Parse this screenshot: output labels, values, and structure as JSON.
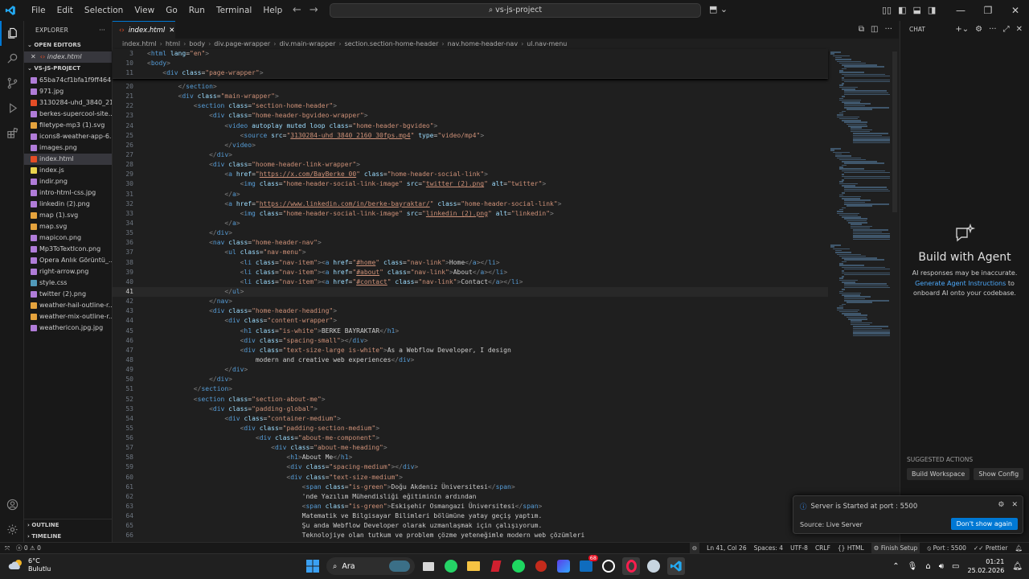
{
  "titlebar": {
    "menu": [
      "File",
      "Edit",
      "Selection",
      "View",
      "Go",
      "Run",
      "Terminal",
      "Help"
    ],
    "search": "vs-js-project"
  },
  "sidebar": {
    "title": "EXPLORER",
    "open_editors": "OPEN EDITORS",
    "open_file": "index.html",
    "project": "VS-JS-PROJECT",
    "files": [
      {
        "name": "65ba74cf1bfa1f9ff464...",
        "color": "#b07cd8"
      },
      {
        "name": "971.jpg",
        "color": "#b07cd8"
      },
      {
        "name": "3130284-uhd_3840_21...",
        "color": "#e44d26"
      },
      {
        "name": "berkes-supercool-site....",
        "color": "#b07cd8"
      },
      {
        "name": "filetype-mp3 (1).svg",
        "color": "#e5a33d"
      },
      {
        "name": "icons8-weather-app-6...",
        "color": "#b07cd8"
      },
      {
        "name": "images.png",
        "color": "#b07cd8"
      },
      {
        "name": "index.html",
        "color": "#e44d26"
      },
      {
        "name": "index.js",
        "color": "#e8d44d"
      },
      {
        "name": "indir.png",
        "color": "#b07cd8"
      },
      {
        "name": "intro-html-css.jpg",
        "color": "#b07cd8"
      },
      {
        "name": "linkedin (2).png",
        "color": "#b07cd8"
      },
      {
        "name": "map (1).svg",
        "color": "#e5a33d"
      },
      {
        "name": "map.svg",
        "color": "#e5a33d"
      },
      {
        "name": "mapicon.png",
        "color": "#b07cd8"
      },
      {
        "name": "Mp3ToTextIcon.png",
        "color": "#b07cd8"
      },
      {
        "name": "Opera Anlık Görüntü_...",
        "color": "#b07cd8"
      },
      {
        "name": "right-arrow.png",
        "color": "#b07cd8"
      },
      {
        "name": "style.css",
        "color": "#519aba"
      },
      {
        "name": "twitter (2).png",
        "color": "#b07cd8"
      },
      {
        "name": "weather-hail-outline-r...",
        "color": "#e5a33d"
      },
      {
        "name": "weather-mix-outline-r...",
        "color": "#e5a33d"
      },
      {
        "name": "weathericon.jpg.jpg",
        "color": "#b07cd8"
      }
    ],
    "outline": "OUTLINE",
    "timeline": "TIMELINE"
  },
  "editor": {
    "tab": "index.html",
    "breadcrumb": [
      "index.html",
      "html",
      "body",
      "div.page-wrapper",
      "div.main-wrapper",
      "section.section-home-header",
      "nav.home-header-nav",
      "ul.nav-menu"
    ],
    "sticky": [
      {
        "n": "3",
        "html": "<span class=\"t\">&lt;</span><span class=\"n\">html</span> <span class=\"a\">lang</span><span class=\"x\">=</span><span class=\"s\">\"en\"</span><span class=\"t\">&gt;</span>"
      },
      {
        "n": "10",
        "html": "<span class=\"t\">&lt;</span><span class=\"n\">body</span><span class=\"t\">&gt;</span>"
      },
      {
        "n": "11",
        "html": "    <span class=\"t\">&lt;</span><span class=\"n\">div</span> <span class=\"a\">class</span><span class=\"x\">=</span><span class=\"s\">\"page-wrapper\"</span><span class=\"t\">&gt;</span>"
      }
    ],
    "lines": [
      {
        "n": "20",
        "html": "        <span class=\"t\">&lt;/</span><span class=\"n\">section</span><span class=\"t\">&gt;</span>"
      },
      {
        "n": "21",
        "html": "        <span class=\"t\">&lt;</span><span class=\"n\">div</span> <span class=\"a\">class</span><span class=\"x\">=</span><span class=\"s\">\"main-wrapper\"</span><span class=\"t\">&gt;</span>"
      },
      {
        "n": "22",
        "html": "            <span class=\"t\">&lt;</span><span class=\"n\">section</span> <span class=\"a\">class</span><span class=\"x\">=</span><span class=\"s\">\"section-home-header\"</span><span class=\"t\">&gt;</span>"
      },
      {
        "n": "23",
        "html": "                <span class=\"t\">&lt;</span><span class=\"n\">div</span> <span class=\"a\">class</span><span class=\"x\">=</span><span class=\"s\">\"home-header-bgvideo-wrapper\"</span><span class=\"t\">&gt;</span>"
      },
      {
        "n": "24",
        "html": "                    <span class=\"t\">&lt;</span><span class=\"n\">video</span> <span class=\"a\">autoplay</span> <span class=\"a\">muted</span> <span class=\"a\">loop</span> <span class=\"a\">class</span><span class=\"x\">=</span><span class=\"s\">\"home-header-bgvideo\"</span><span class=\"t\">&gt;</span>"
      },
      {
        "n": "25",
        "html": "                        <span class=\"t\">&lt;</span><span class=\"n\">source</span> <span class=\"a\">src</span><span class=\"x\">=</span><span class=\"s\">\"<span class=\"u\">3130284-uhd_3840_2160_30fps.mp4</span>\"</span> <span class=\"a\">type</span><span class=\"x\">=</span><span class=\"s\">\"video/mp4\"</span><span class=\"t\">&gt;</span>"
      },
      {
        "n": "26",
        "html": "                    <span class=\"t\">&lt;/</span><span class=\"n\">video</span><span class=\"t\">&gt;</span>"
      },
      {
        "n": "27",
        "html": "                <span class=\"t\">&lt;/</span><span class=\"n\">div</span><span class=\"t\">&gt;</span>"
      },
      {
        "n": "28",
        "html": "                <span class=\"t\">&lt;</span><span class=\"n\">div</span> <span class=\"a\">class</span><span class=\"x\">=</span><span class=\"s\">\"hoome-header-link-wrapper\"</span><span class=\"t\">&gt;</span>"
      },
      {
        "n": "29",
        "html": "                    <span class=\"t\">&lt;</span><span class=\"n\">a</span> <span class=\"a\">href</span><span class=\"x\">=</span><span class=\"s\">\"<span class=\"u\">https://x.com/BayBerke_00</span>\"</span> <span class=\"a\">class</span><span class=\"x\">=</span><span class=\"s\">\"home-header-social-link\"</span><span class=\"t\">&gt;</span>"
      },
      {
        "n": "30",
        "html": "                        <span class=\"t\">&lt;</span><span class=\"n\">img</span> <span class=\"a\">class</span><span class=\"x\">=</span><span class=\"s\">\"home-header-social-link-image\"</span> <span class=\"a\">src</span><span class=\"x\">=</span><span class=\"s\">\"<span class=\"u\">twitter (2).png</span>\"</span> <span class=\"a\">alt</span><span class=\"x\">=</span><span class=\"s\">\"twitter\"</span><span class=\"t\">&gt;</span>"
      },
      {
        "n": "31",
        "html": "                    <span class=\"t\">&lt;/</span><span class=\"n\">a</span><span class=\"t\">&gt;</span>"
      },
      {
        "n": "32",
        "html": "                    <span class=\"t\">&lt;</span><span class=\"n\">a</span> <span class=\"a\">href</span><span class=\"x\">=</span><span class=\"s\">\"<span class=\"u\">https://www.linkedin.com/in/berke-bayraktar/</span>\"</span> <span class=\"a\">class</span><span class=\"x\">=</span><span class=\"s\">\"home-header-social-link\"</span><span class=\"t\">&gt;</span>"
      },
      {
        "n": "33",
        "html": "                        <span class=\"t\">&lt;</span><span class=\"n\">img</span> <span class=\"a\">class</span><span class=\"x\">=</span><span class=\"s\">\"home-header-social-link-image\"</span> <span class=\"a\">src</span><span class=\"x\">=</span><span class=\"s\">\"<span class=\"u\">linkedin (2).png</span>\"</span> <span class=\"a\">alt</span><span class=\"x\">=</span><span class=\"s\">\"linkedin\"</span><span class=\"t\">&gt;</span>"
      },
      {
        "n": "34",
        "html": "                    <span class=\"t\">&lt;/</span><span class=\"n\">a</span><span class=\"t\">&gt;</span>"
      },
      {
        "n": "35",
        "html": "                <span class=\"t\">&lt;/</span><span class=\"n\">div</span><span class=\"t\">&gt;</span>"
      },
      {
        "n": "36",
        "html": "                <span class=\"t\">&lt;</span><span class=\"n\">nav</span> <span class=\"a\">class</span><span class=\"x\">=</span><span class=\"s\">\"home-header-nav\"</span><span class=\"t\">&gt;</span>"
      },
      {
        "n": "37",
        "html": "                    <span class=\"t\">&lt;</span><span class=\"n\">ul</span> <span class=\"a\">class</span><span class=\"x\">=</span><span class=\"s\">\"nav-menu\"</span><span class=\"t\">&gt;</span>"
      },
      {
        "n": "38",
        "html": "                        <span class=\"t\">&lt;</span><span class=\"n\">li</span> <span class=\"a\">class</span><span class=\"x\">=</span><span class=\"s\">\"nav-item\"</span><span class=\"t\">&gt;&lt;</span><span class=\"n\">a</span> <span class=\"a\">href</span><span class=\"x\">=</span><span class=\"s\">\"<span class=\"u\">#home</span>\"</span> <span class=\"a\">class</span><span class=\"x\">=</span><span class=\"s\">\"nav-link\"</span><span class=\"t\">&gt;</span>Home<span class=\"t\">&lt;/</span><span class=\"n\">a</span><span class=\"t\">&gt;&lt;/</span><span class=\"n\">li</span><span class=\"t\">&gt;</span>"
      },
      {
        "n": "39",
        "html": "                        <span class=\"t\">&lt;</span><span class=\"n\">li</span> <span class=\"a\">class</span><span class=\"x\">=</span><span class=\"s\">\"nav-item\"</span><span class=\"t\">&gt;&lt;</span><span class=\"n\">a</span> <span class=\"a\">href</span><span class=\"x\">=</span><span class=\"s\">\"<span class=\"u\">#about</span>\"</span> <span class=\"a\">class</span><span class=\"x\">=</span><span class=\"s\">\"nav-link\"</span><span class=\"t\">&gt;</span>About<span class=\"t\">&lt;/</span><span class=\"n\">a</span><span class=\"t\">&gt;&lt;/</span><span class=\"n\">li</span><span class=\"t\">&gt;</span>"
      },
      {
        "n": "40",
        "html": "                        <span class=\"t\">&lt;</span><span class=\"n\">li</span> <span class=\"a\">class</span><span class=\"x\">=</span><span class=\"s\">\"nav-item\"</span><span class=\"t\">&gt;&lt;</span><span class=\"n\">a</span> <span class=\"a\">href</span><span class=\"x\">=</span><span class=\"s\">\"<span class=\"u\">#contact</span>\"</span> <span class=\"a\">class</span><span class=\"x\">=</span><span class=\"s\">\"nav-link\"</span><span class=\"t\">&gt;</span>Contact<span class=\"t\">&lt;/</span><span class=\"n\">a</span><span class=\"t\">&gt;&lt;/</span><span class=\"n\">li</span><span class=\"t\">&gt;</span>"
      },
      {
        "n": "41",
        "html": "                    <span class=\"t\">&lt;/</span><span class=\"n\">ul</span><span class=\"t\">&gt;</span>",
        "current": true
      },
      {
        "n": "42",
        "html": "                <span class=\"t\">&lt;/</span><span class=\"n\">nav</span><span class=\"t\">&gt;</span>"
      },
      {
        "n": "43",
        "html": "                <span class=\"t\">&lt;</span><span class=\"n\">div</span> <span class=\"a\">class</span><span class=\"x\">=</span><span class=\"s\">\"home-header-heading\"</span><span class=\"t\">&gt;</span>"
      },
      {
        "n": "44",
        "html": "                    <span class=\"t\">&lt;</span><span class=\"n\">div</span> <span class=\"a\">class</span><span class=\"x\">=</span><span class=\"s\">\"content-wrapper\"</span><span class=\"t\">&gt;</span>"
      },
      {
        "n": "45",
        "html": "                        <span class=\"t\">&lt;</span><span class=\"n\">h1</span> <span class=\"a\">class</span><span class=\"x\">=</span><span class=\"s\">\"is-white\"</span><span class=\"t\">&gt;</span>BERKE BAYRAKTAR<span class=\"t\">&lt;/</span><span class=\"n\">h1</span><span class=\"t\">&gt;</span>"
      },
      {
        "n": "46",
        "html": "                        <span class=\"t\">&lt;</span><span class=\"n\">div</span> <span class=\"a\">class</span><span class=\"x\">=</span><span class=\"s\">\"spacing-small\"</span><span class=\"t\">&gt;&lt;/</span><span class=\"n\">div</span><span class=\"t\">&gt;</span>"
      },
      {
        "n": "47",
        "html": "                        <span class=\"t\">&lt;</span><span class=\"n\">div</span> <span class=\"a\">class</span><span class=\"x\">=</span><span class=\"s\">\"text-size-large is-white\"</span><span class=\"t\">&gt;</span>As a Webflow Developer, I design"
      },
      {
        "n": "48",
        "html": "                            modern and creative web experiences<span class=\"t\">&lt;/</span><span class=\"n\">div</span><span class=\"t\">&gt;</span>"
      },
      {
        "n": "49",
        "html": "                    <span class=\"t\">&lt;/</span><span class=\"n\">div</span><span class=\"t\">&gt;</span>"
      },
      {
        "n": "50",
        "html": "                <span class=\"t\">&lt;/</span><span class=\"n\">div</span><span class=\"t\">&gt;</span>"
      },
      {
        "n": "51",
        "html": "            <span class=\"t\">&lt;/</span><span class=\"n\">section</span><span class=\"t\">&gt;</span>"
      },
      {
        "n": "52",
        "html": "            <span class=\"t\">&lt;</span><span class=\"n\">section</span> <span class=\"a\">class</span><span class=\"x\">=</span><span class=\"s\">\"section-about-me\"</span><span class=\"t\">&gt;</span>"
      },
      {
        "n": "53",
        "html": "                <span class=\"t\">&lt;</span><span class=\"n\">div</span> <span class=\"a\">class</span><span class=\"x\">=</span><span class=\"s\">\"padding-global\"</span><span class=\"t\">&gt;</span>"
      },
      {
        "n": "54",
        "html": "                    <span class=\"t\">&lt;</span><span class=\"n\">div</span> <span class=\"a\">class</span><span class=\"x\">=</span><span class=\"s\">\"container-medium\"</span><span class=\"t\">&gt;</span>"
      },
      {
        "n": "55",
        "html": "                        <span class=\"t\">&lt;</span><span class=\"n\">div</span> <span class=\"a\">class</span><span class=\"x\">=</span><span class=\"s\">\"padding-section-medium\"</span><span class=\"t\">&gt;</span>"
      },
      {
        "n": "56",
        "html": "                            <span class=\"t\">&lt;</span><span class=\"n\">div</span> <span class=\"a\">class</span><span class=\"x\">=</span><span class=\"s\">\"about-me-component\"</span><span class=\"t\">&gt;</span>"
      },
      {
        "n": "57",
        "html": "                                <span class=\"t\">&lt;</span><span class=\"n\">div</span> <span class=\"a\">class</span><span class=\"x\">=</span><span class=\"s\">\"about-me-heading\"</span><span class=\"t\">&gt;</span>"
      },
      {
        "n": "58",
        "html": "                                    <span class=\"t\">&lt;</span><span class=\"n\">h1</span><span class=\"t\">&gt;</span>About Me<span class=\"t\">&lt;/</span><span class=\"n\">h1</span><span class=\"t\">&gt;</span>"
      },
      {
        "n": "59",
        "html": "                                    <span class=\"t\">&lt;</span><span class=\"n\">div</span> <span class=\"a\">class</span><span class=\"x\">=</span><span class=\"s\">\"spacing-medium\"</span><span class=\"t\">&gt;&lt;/</span><span class=\"n\">div</span><span class=\"t\">&gt;</span>"
      },
      {
        "n": "60",
        "html": "                                    <span class=\"t\">&lt;</span><span class=\"n\">div</span> <span class=\"a\">class</span><span class=\"x\">=</span><span class=\"s\">\"text-size-medium\"</span><span class=\"t\">&gt;</span>"
      },
      {
        "n": "61",
        "html": "                                        <span class=\"t\">&lt;</span><span class=\"n\">span</span> <span class=\"a\">class</span><span class=\"x\">=</span><span class=\"s\">\"is-green\"</span><span class=\"t\">&gt;</span>Doğu Akdeniz Üniversitesi<span class=\"t\">&lt;/</span><span class=\"n\">span</span><span class=\"t\">&gt;</span>"
      },
      {
        "n": "62",
        "html": "                                        'nde Yazılım Mühendisliği eğitiminin ardından"
      },
      {
        "n": "63",
        "html": "                                        <span class=\"t\">&lt;</span><span class=\"n\">span</span> <span class=\"a\">class</span><span class=\"x\">=</span><span class=\"s\">\"is-green\"</span><span class=\"t\">&gt;</span>Eskişehir Osmangazi Üniversitesi<span class=\"t\">&lt;/</span><span class=\"n\">span</span><span class=\"t\">&gt;</span>"
      },
      {
        "n": "64",
        "html": "                                        Matematik ve Bilgisayar Bilimleri bölümüne yatay geçiş yaptım."
      },
      {
        "n": "65",
        "html": "                                        Şu anda Webflow Developer olarak uzmanlaşmak için çalışıyorum."
      },
      {
        "n": "66",
        "html": "                                        Teknolojiye olan tutkum ve problem çözme yeteneğimle modern web çözümleri"
      }
    ]
  },
  "chat": {
    "title": "CHAT",
    "heading": "Build with Agent",
    "line1": "AI responses may be inaccurate.",
    "link": "Generate Agent Instructions",
    "line2a": "to",
    "line2b": "onboard AI onto your codebase.",
    "suggested": "SUGGESTED ACTIONS",
    "btn1": "Build Workspace",
    "btn2": "Show Config"
  },
  "notification": {
    "message": "Server is Started at port : 5500",
    "source": "Source: Live Server",
    "button": "Don't show again"
  },
  "statusbar": {
    "errors": "0",
    "warnings": "0",
    "position": "Ln 41, Col 26",
    "spaces": "Spaces: 4",
    "encoding": "UTF-8",
    "eol": "CRLF",
    "lang": "HTML",
    "finish": "Finish Setup",
    "port": "Port : 5500",
    "prettier": "Prettier"
  },
  "taskbar": {
    "temp": "6°C",
    "weather": "Bulutlu",
    "search": "Ara",
    "badge": "68",
    "time": "01:21",
    "date": "25.02.2026"
  }
}
